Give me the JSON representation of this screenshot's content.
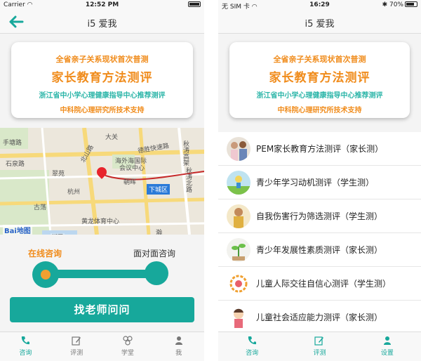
{
  "colors": {
    "accent": "#17a89b",
    "orange": "#f08c1c",
    "tab_inactive": "#777777"
  },
  "screen1": {
    "status": {
      "carrier": "Carrier",
      "time": "12:52 PM"
    },
    "nav": {
      "title": "i5 爱我",
      "back_icon": "back-arrow-icon"
    },
    "banner": {
      "line1": "全省亲子关系现状首次普测",
      "line2": "家长教育方法测评",
      "line3": "浙江省中小学心理健康指导中心推荐测评",
      "line4": "中科院心理研究所技术支持"
    },
    "map": {
      "labels": [
        "手塘路",
        "大关",
        "德胜快速路",
        "秋涛高架",
        "海外海国际",
        "会议中心",
        "朝晖",
        "翠苑",
        "秋涛北路",
        "古荡",
        "黄龙体育中心",
        "瀚",
        "北山路",
        "石泉路",
        "杭州",
        "湖区"
      ],
      "district": "下城区",
      "logo": "Bai",
      "logo2": "地图"
    },
    "consult": {
      "option_online": "在线咨询",
      "option_offline": "面对面咨询",
      "button": "找老师问问"
    },
    "tabs": [
      {
        "label": "咨询",
        "icon": "phone-icon",
        "active": true
      },
      {
        "label": "评测",
        "icon": "edit-icon",
        "active": false
      },
      {
        "label": "学堂",
        "icon": "community-icon",
        "active": false
      },
      {
        "label": "我",
        "icon": "user-icon",
        "active": false
      }
    ]
  },
  "screen2": {
    "status": {
      "carrier": "无 SIM 卡",
      "time": "16:29",
      "battery": "70%"
    },
    "nav": {
      "title": "i5 爱我"
    },
    "banner": {
      "line1": "全省亲子关系现状首次普测",
      "line2": "家长教育方法测评",
      "line3": "浙江省中小学心理健康指导中心推荐测评",
      "line4": "中科院心理研究所技术支持"
    },
    "tests": [
      {
        "name": "PEM家长教育方法测评（家长测）"
      },
      {
        "name": "青少年学习动机测评（学生测）"
      },
      {
        "name": "自我伤害行为筛选测评（学生测）"
      },
      {
        "name": "青少年发展性素质测评（家长测）"
      },
      {
        "name": "儿童人际交往自信心测评（学生测）"
      },
      {
        "name": "儿童社会适应能力测评（家长测）"
      }
    ],
    "tabs": [
      {
        "label": "咨询",
        "icon": "phone-icon",
        "active": false
      },
      {
        "label": "评测",
        "icon": "edit-icon",
        "active": true
      },
      {
        "label": "设置",
        "icon": "user-icon",
        "active": false
      }
    ]
  }
}
